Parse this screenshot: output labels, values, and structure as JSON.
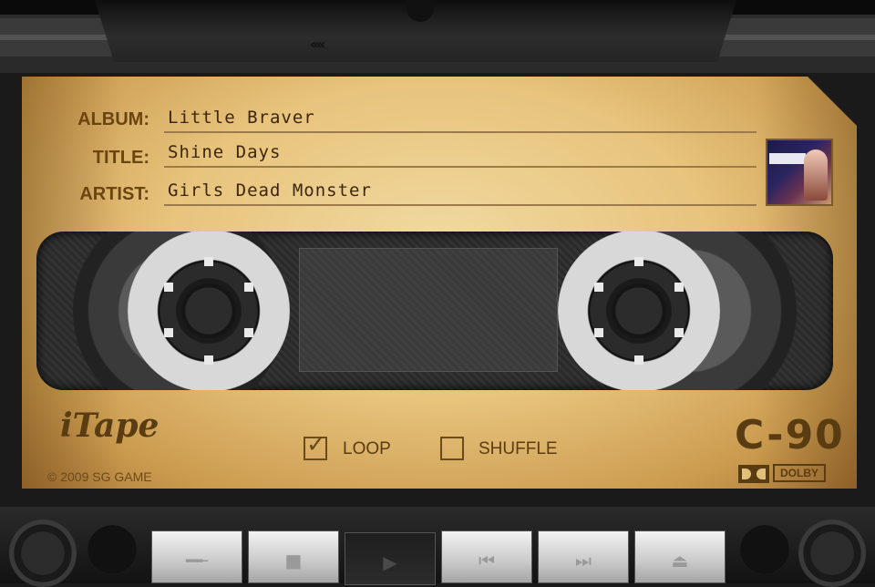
{
  "fields": {
    "album_key": "ALBUM:",
    "album_value": "Little Braver",
    "title_key": "TITLE:",
    "title_value": "Shine Days",
    "artist_key": "ARTIST:",
    "artist_value": "Girls Dead Monster"
  },
  "options": {
    "loop_label": "LOOP",
    "loop_checked": true,
    "shuffle_label": "SHUFFLE",
    "shuffle_checked": false
  },
  "branding": {
    "app_name": "iTape",
    "copyright": "© 2009 SG GAME",
    "tape_type": "C-90",
    "dolby": "DOLBY"
  },
  "controls": [
    {
      "name": "settings",
      "icon": "wrench-icon"
    },
    {
      "name": "stop",
      "icon": "stop-icon"
    },
    {
      "name": "play",
      "icon": "play-icon",
      "pressed": true
    },
    {
      "name": "previous",
      "icon": "previous-track-icon"
    },
    {
      "name": "next",
      "icon": "next-track-icon"
    },
    {
      "name": "eject",
      "icon": "eject-icon"
    }
  ],
  "colors": {
    "tape_body": "#e8c47d",
    "label_ink": "#5a3c12"
  }
}
